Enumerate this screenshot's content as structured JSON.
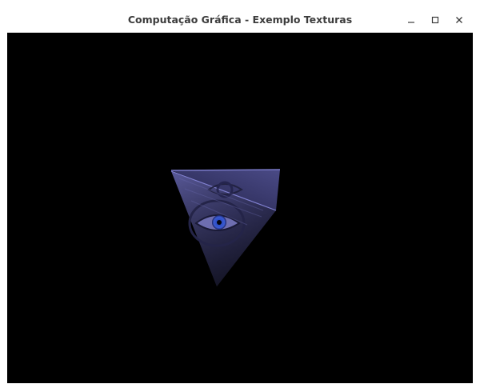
{
  "window": {
    "title": "Computação Gráfica - Exemplo Texturas",
    "controls": {
      "minimize": "minimize-icon",
      "maximize": "maximize-icon",
      "close": "close-icon"
    }
  },
  "viewport": {
    "background_color": "#000000",
    "object": {
      "shape": "textured tetrahedron",
      "texture_motif": "eye-in-triangle",
      "base_color": "#3a3a6e",
      "iris_color": "#3050c0"
    }
  }
}
